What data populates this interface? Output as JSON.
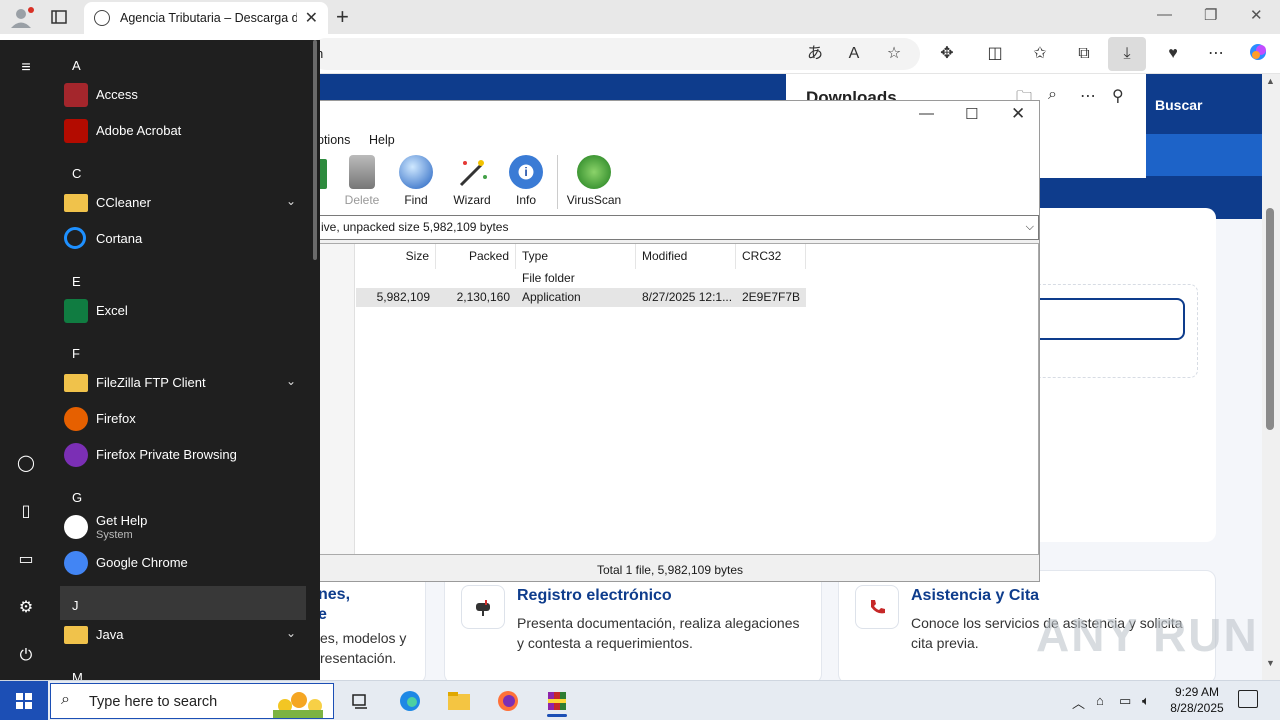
{
  "browser": {
    "tab_title": "Agencia Tributaria – Descarga de",
    "address_text": "n",
    "colors": {
      "accent": "#0e3c8c"
    }
  },
  "downloads_panel": {
    "title": "Downloads"
  },
  "page": {
    "search_button": "Buscar",
    "cards": [
      {
        "title_line1": "nes,",
        "title_line2": "e",
        "desc_line1": "es, modelos y",
        "desc_line2": "resentación."
      },
      {
        "title": "Registro electrónico",
        "desc_line1": "Presenta documentación, realiza alegaciones",
        "desc_line2": "y contesta a requerimientos.",
        "icon": "mailbox-icon"
      },
      {
        "title": "Asistencia y Cita",
        "desc_line1": "Conoce los servicios de asistencia y solicita",
        "desc_line2": "cita previa.",
        "icon": "phone-icon"
      }
    ],
    "watermark": "ANY RUN"
  },
  "winrar": {
    "menu": [
      "ptions",
      "Help"
    ],
    "tools": [
      {
        "label": "Delete",
        "disabled": true,
        "icon": "trash-icon"
      },
      {
        "label": "Find",
        "disabled": false,
        "icon": "magnifier-icon"
      },
      {
        "label": "Wizard",
        "disabled": false,
        "icon": "wand-icon"
      },
      {
        "label": "Info",
        "disabled": false,
        "icon": "info-icon"
      },
      {
        "label": "VirusScan",
        "disabled": false,
        "icon": "bug-icon"
      }
    ],
    "path_text": "ive, unpacked size 5,982,109 bytes",
    "columns": [
      "Size",
      "Packed",
      "Type",
      "Modified",
      "CRC32"
    ],
    "rows": [
      {
        "size": "",
        "packed": "",
        "type": "File folder",
        "modified": "",
        "crc": ""
      },
      {
        "size": "5,982,109",
        "packed": "2,130,160",
        "type": "Application",
        "modified": "8/27/2025 12:1...",
        "crc": "2E9E7F7B"
      }
    ],
    "status": "Total 1 file, 5,982,109 bytes"
  },
  "start_menu": {
    "groups": [
      {
        "letter": "A",
        "apps": [
          {
            "name": "Access",
            "icon": "access-icon",
            "color": "#a4262c"
          },
          {
            "name": "Adobe Acrobat",
            "icon": "acrobat-icon",
            "color": "#b30b00"
          }
        ]
      },
      {
        "letter": "C",
        "apps": [
          {
            "name": "CCleaner",
            "icon": "folder-icon",
            "color": "#f0c24b",
            "folder": true
          },
          {
            "name": "Cortana",
            "icon": "cortana-icon",
            "color": "#1e90ff"
          }
        ]
      },
      {
        "letter": "E",
        "apps": [
          {
            "name": "Excel",
            "icon": "excel-icon",
            "color": "#107c41"
          }
        ]
      },
      {
        "letter": "F",
        "apps": [
          {
            "name": "FileZilla FTP Client",
            "icon": "folder-icon",
            "color": "#f0c24b",
            "folder": true
          },
          {
            "name": "Firefox",
            "icon": "firefox-icon",
            "color": "#e66000"
          },
          {
            "name": "Firefox Private Browsing",
            "icon": "firefox-private-icon",
            "color": "#7b2fb5"
          }
        ]
      },
      {
        "letter": "G",
        "apps": [
          {
            "name": "Get Help",
            "sub": "System",
            "icon": "get-help-icon",
            "color": "#ffffff"
          },
          {
            "name": "Google Chrome",
            "icon": "chrome-icon",
            "color": "#4285f4"
          }
        ]
      },
      {
        "letter": "J",
        "apps": [
          {
            "name": "Java",
            "icon": "folder-icon",
            "color": "#f0c24b",
            "folder": true
          }
        ]
      },
      {
        "letter": "M",
        "apps": []
      }
    ]
  },
  "taskbar": {
    "search_placeholder": "Type here to search",
    "time": "9:29 AM",
    "date": "8/28/2025"
  }
}
